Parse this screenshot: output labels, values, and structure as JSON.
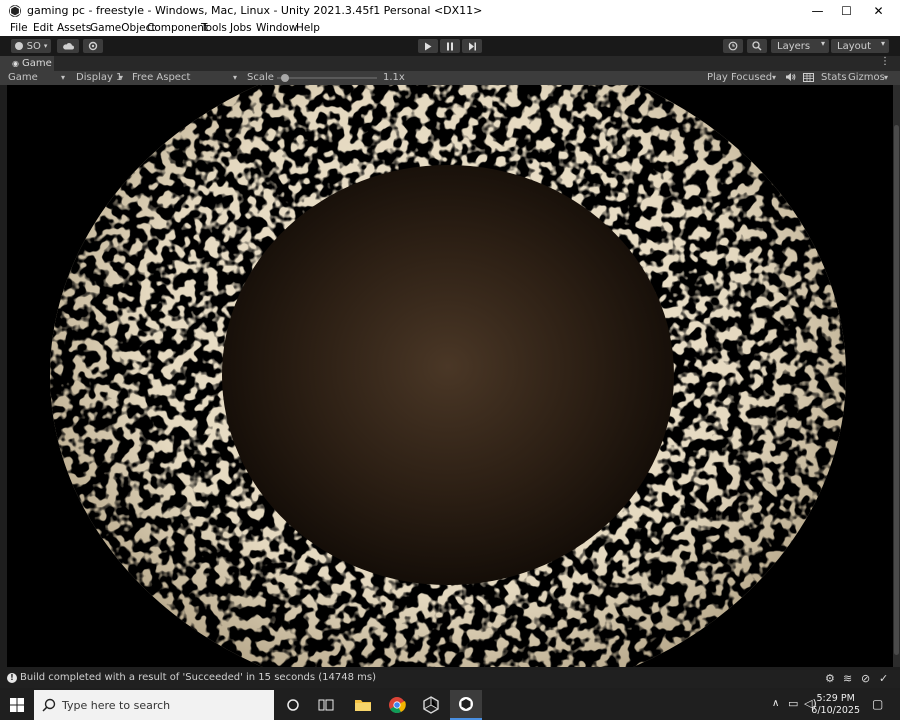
{
  "window": {
    "title": "gaming pc - freestyle - Windows, Mac, Linux - Unity 2021.3.45f1 Personal <DX11>",
    "minimize": "—",
    "maximize": "☐",
    "close": "✕"
  },
  "menu": [
    "File",
    "Edit",
    "Assets",
    "GameObject",
    "Component",
    "Tools",
    "Jobs",
    "Window",
    "Help"
  ],
  "toolbar": {
    "account_label": "SO",
    "layers_label": "Layers",
    "layout_label": "Layout"
  },
  "game_tab": {
    "label": "Game"
  },
  "game_bar": {
    "view_select": "Game",
    "display_select": "Display 1",
    "aspect_select": "Free Aspect",
    "scale_label": "Scale",
    "scale_value": "1.1x",
    "scale_fraction": 0.08,
    "play_mode_select": "Play Focused",
    "stats_label": "Stats",
    "gizmos_label": "Gizmos"
  },
  "status": {
    "message": "Build completed with a result of 'Succeeded' in 15 seconds (14748 ms)"
  },
  "taskbar": {
    "search_placeholder": "Type here to search",
    "time": "5:29 PM",
    "date": "6/10/2025"
  },
  "colors": {
    "accent": "#4a90e2",
    "sphere_outer": "#e2d6bd",
    "sphere_inner": "#3a2a1c"
  },
  "icons": [
    "unity-icon",
    "cloud-icon",
    "gear-icon",
    "play-icon",
    "pause-icon",
    "step-icon",
    "history-icon",
    "search-icon",
    "audio-icon",
    "windows-start-icon",
    "task-view-icon",
    "file-explorer-icon",
    "chrome-icon",
    "unity-hub-icon",
    "unity-editor-icon"
  ]
}
